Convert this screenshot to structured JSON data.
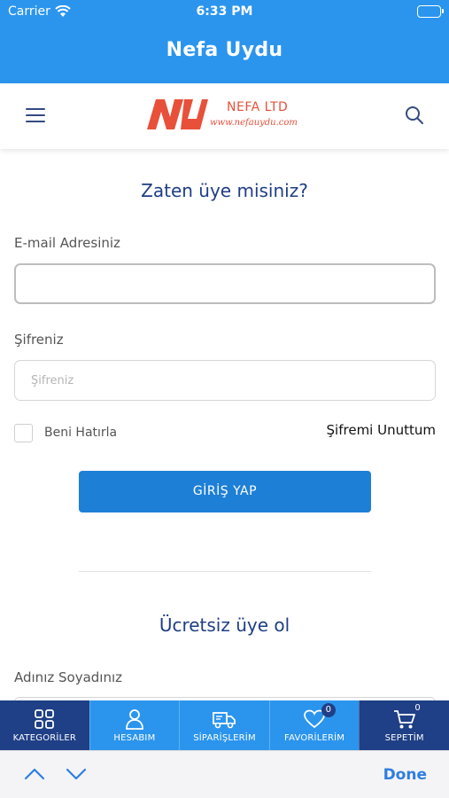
{
  "status_bar": {
    "carrier": "Carrier",
    "time": "6:33 PM"
  },
  "app": {
    "title": "Nefa Uydu"
  },
  "header": {
    "menu_icon": "hamburger-menu-icon",
    "search_icon": "search-icon",
    "logo": {
      "mark": "NU",
      "name": "NEFA LTD",
      "url": "www.nefauydu.com"
    }
  },
  "login": {
    "title": "Zaten üye misiniz?",
    "email_label": "E-mail Adresiniz",
    "email_value": "",
    "password_label": "Şifreniz",
    "password_placeholder": "Şifreniz",
    "remember_label": "Beni Hatırla",
    "forgot_label": "Şifremi Unuttum",
    "submit_label": "GİRİŞ YAP"
  },
  "register": {
    "title": "Ücretsiz üye ol",
    "name_label": "Adınız Soyadınız"
  },
  "tabbar": {
    "tabs": [
      {
        "label": "KATEGORİLER",
        "icon": "grid-icon"
      },
      {
        "label": "HESABIM",
        "icon": "user-icon"
      },
      {
        "label": "SİPARİŞLERİM",
        "icon": "truck-icon"
      },
      {
        "label": "FAVORİLERİM",
        "icon": "heart-icon",
        "badge": "0"
      },
      {
        "label": "SEPETİM",
        "icon": "cart-icon",
        "badge": "0"
      }
    ]
  },
  "keyboard_accessory": {
    "done_label": "Done"
  },
  "colors": {
    "primary": "#2b95ee",
    "dark_blue": "#1f3f86",
    "button": "#1e7fd6",
    "logo_red": "#e8503a",
    "heading": "#1e3e84"
  }
}
